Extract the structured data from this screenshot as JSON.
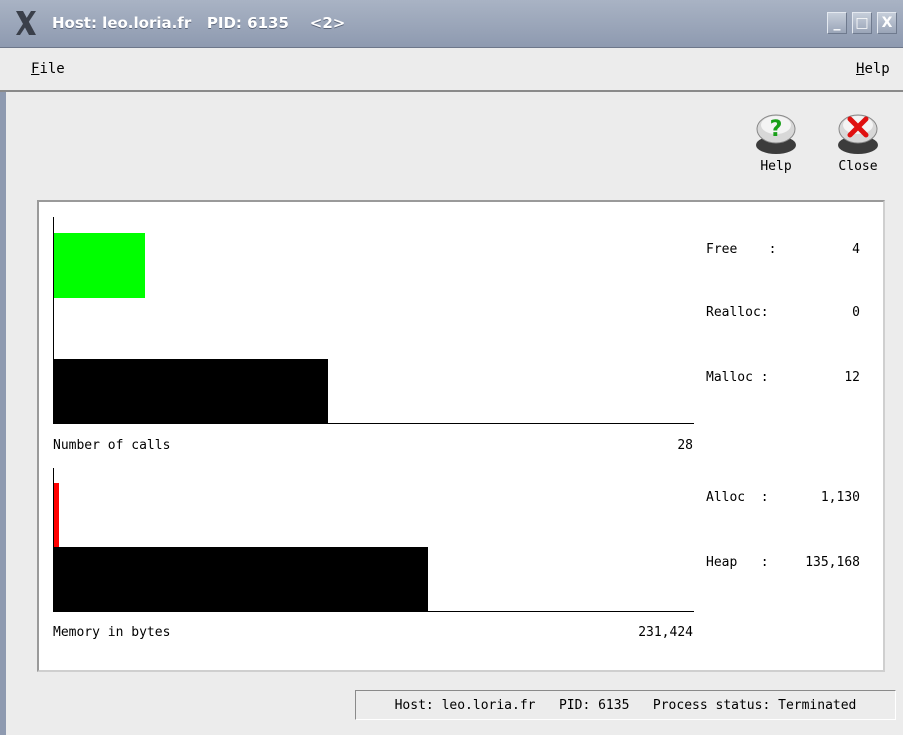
{
  "window": {
    "title": "Host: leo.loria.fr   PID: 6135    <2>",
    "buttons": {
      "minimize": "_",
      "maximize": "□",
      "close": "X"
    }
  },
  "menubar": {
    "file": {
      "mnemonic": "F",
      "rest": "ile"
    },
    "help": {
      "mnemonic": "H",
      "rest": "elp"
    }
  },
  "toolbar": {
    "help_label": "Help",
    "close_label": "Close",
    "help_icon": "question-icon",
    "close_icon": "x-icon"
  },
  "calls_chart": {
    "caption": "Number of calls",
    "total": "28",
    "max": 28,
    "bars": [
      {
        "name": "free",
        "value": 4,
        "color": "#00ff00"
      },
      {
        "name": "malloc",
        "value": 12,
        "color": "#000000"
      }
    ]
  },
  "memory_chart": {
    "caption": "Memory in bytes",
    "total": "231,424",
    "max": 231424,
    "bars": [
      {
        "name": "alloc",
        "value": 1130,
        "color": "#ff0000"
      },
      {
        "name": "heap",
        "value": 135168,
        "color": "#000000"
      }
    ]
  },
  "stats": {
    "free": {
      "label": "Free    :",
      "value": "4"
    },
    "realloc": {
      "label": "Realloc:",
      "value": "0"
    },
    "malloc": {
      "label": "Malloc :",
      "value": "12"
    },
    "alloc": {
      "label": "Alloc  :",
      "value": "1,130"
    },
    "heap": {
      "label": "Heap   :",
      "value": "135,168"
    }
  },
  "status": {
    "text": "Host: leo.loria.fr   PID: 6135   Process status: Terminated"
  }
}
